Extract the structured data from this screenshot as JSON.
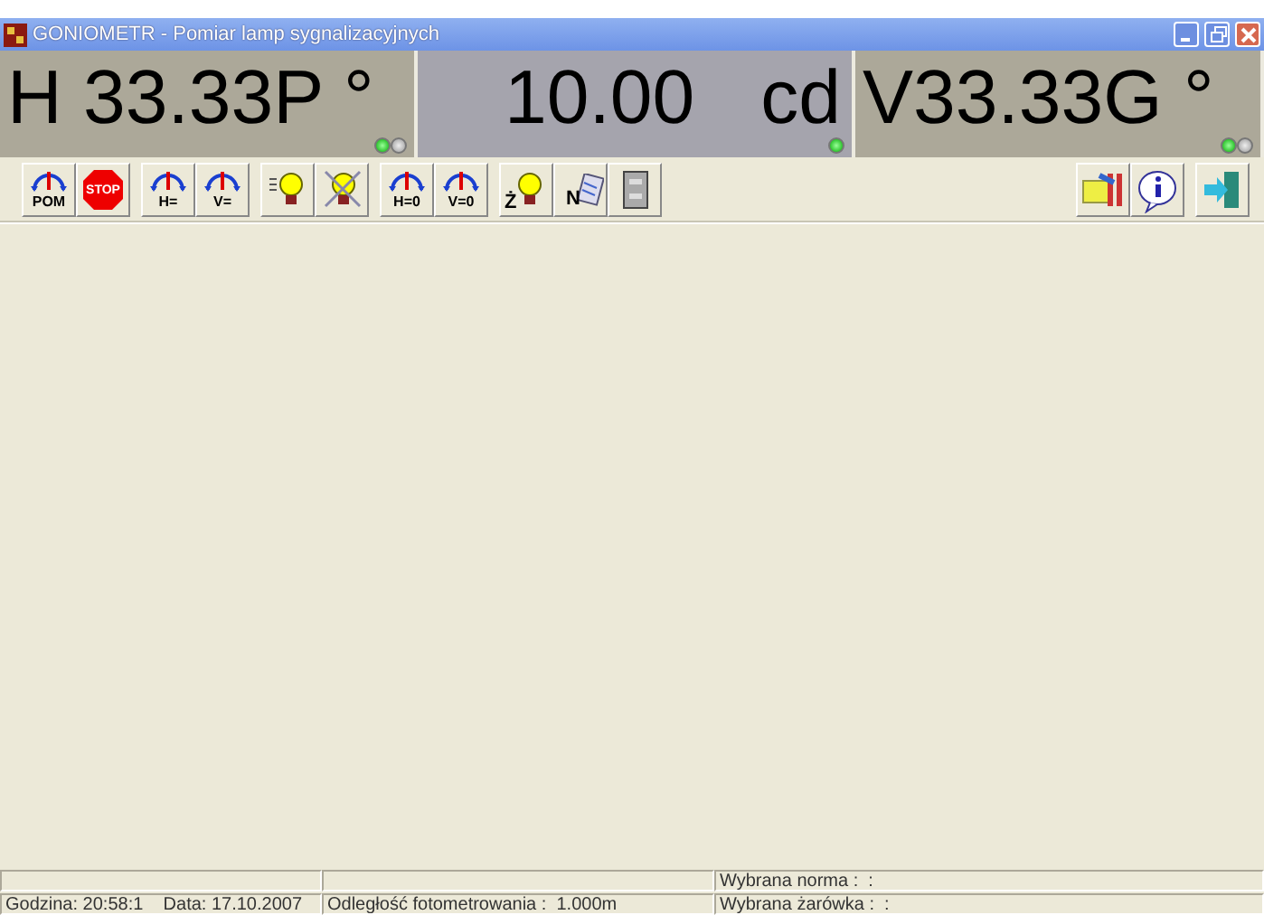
{
  "window": {
    "title": "GONIOMETR - Pomiar lamp sygnalizacyjnych"
  },
  "displays": [
    {
      "kind": "angle",
      "text": "H 33.33P °",
      "leds": [
        {
          "on": true
        },
        {
          "on": false
        }
      ]
    },
    {
      "kind": "intensity",
      "value": "10.00",
      "unit": "cd",
      "leds": [
        {
          "on": true
        }
      ]
    },
    {
      "kind": "angle",
      "text": "V33.33G °",
      "leds": [
        {
          "on": true
        },
        {
          "on": false
        }
      ]
    }
  ],
  "toolbar_left": [
    [
      {
        "kind": "gauge",
        "label": "POM"
      },
      {
        "kind": "stop",
        "label": "STOP"
      }
    ],
    [
      {
        "kind": "gauge",
        "label": "H="
      },
      {
        "kind": "gauge",
        "label": "V="
      }
    ],
    [
      {
        "kind": "bulb"
      },
      {
        "kind": "bulb-off"
      }
    ],
    [
      {
        "kind": "gauge",
        "label": "H=0"
      },
      {
        "kind": "gauge",
        "label": "V=0"
      }
    ],
    [
      {
        "kind": "bulb-z",
        "label": "Ż"
      },
      {
        "kind": "notes",
        "label": "N"
      },
      {
        "kind": "cabinet"
      }
    ]
  ],
  "toolbar_right": [
    [
      {
        "kind": "tools"
      },
      {
        "kind": "info"
      }
    ],
    [
      {
        "kind": "exit"
      }
    ]
  ],
  "status_bar": {
    "rows": [
      {
        "cells": [
          {},
          {},
          {
            "text": "Wybrana norma :  :"
          }
        ]
      },
      {
        "cells": [
          {
            "text": "Godzina: 20:58:1    Data: 17.10.2007"
          },
          {
            "text": "Odległość fotometrowania :  1.000m"
          },
          {
            "text": "Wybrana żarówka :  :"
          }
        ]
      }
    ]
  }
}
